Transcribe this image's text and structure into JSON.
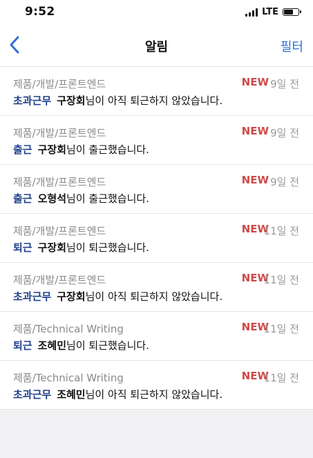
{
  "status_bar": {
    "time": "9:52",
    "network": "LTE"
  },
  "nav": {
    "back_icon": "chevron-left-icon",
    "title": "알림",
    "filter_label": "필터"
  },
  "colors": {
    "accent": "#2f6fd2",
    "new_badge": "#d14949",
    "type_label": "#1e3f8a"
  },
  "notifications": [
    {
      "category": "제품/개발/프론트엔드",
      "badge": "NEW",
      "time": "9일 전",
      "type": "초과근무",
      "name": "구장회",
      "text": "님이 아직 퇴근하지 않았습니다."
    },
    {
      "category": "제품/개발/프론트엔드",
      "badge": "NEW",
      "time": "9일 전",
      "type": "출근",
      "name": "구장회",
      "text": "님이 출근했습니다."
    },
    {
      "category": "제품/개발/프론트엔드",
      "badge": "NEW",
      "time": "9일 전",
      "type": "출근",
      "name": "오형석",
      "text": "님이 출근했습니다."
    },
    {
      "category": "제품/개발/프론트엔드",
      "badge": "NEW",
      "time": "11일 전",
      "type": "퇴근",
      "name": "구장회",
      "text": "님이 퇴근했습니다."
    },
    {
      "category": "제품/개발/프론트엔드",
      "badge": "NEW",
      "time": "11일 전",
      "type": "초과근무",
      "name": "구장회",
      "text": "님이 아직 퇴근하지 않았습니다."
    },
    {
      "category": "제품/Technical Writing",
      "badge": "NEW",
      "time": "11일 전",
      "type": "퇴근",
      "name": "조혜민",
      "text": "님이 퇴근했습니다."
    },
    {
      "category": "제품/Technical Writing",
      "badge": "NEW",
      "time": "11일 전",
      "type": "초과근무",
      "name": "조혜민",
      "text": "님이 아직 퇴근하지 않았습니다."
    }
  ]
}
